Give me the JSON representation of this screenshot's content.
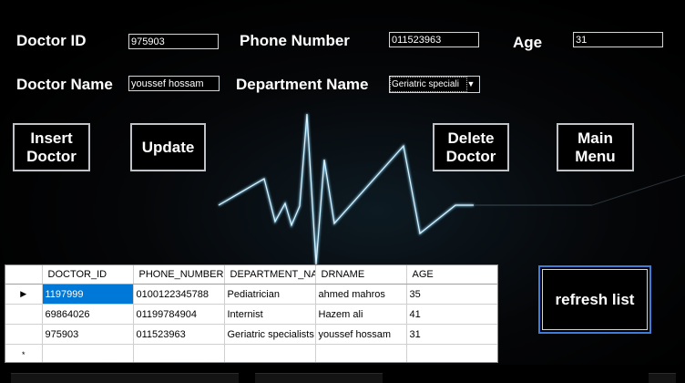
{
  "form": {
    "labels": {
      "doctor_id": "Doctor ID",
      "phone_number": "Phone Number",
      "age": "Age",
      "doctor_name": "Doctor Name",
      "department_name": "Department Name"
    },
    "fields": {
      "doctor_id": "975903",
      "phone_number": "011523963",
      "age": "31",
      "doctor_name": "youssef hossam",
      "department": "Geriatric speciali"
    }
  },
  "buttons": {
    "insert": "Insert Doctor",
    "update": "Update",
    "delete": "Delete Doctor",
    "main_menu": "Main Menu",
    "refresh": "refresh list"
  },
  "grid": {
    "columns": [
      "DOCTOR_ID",
      "PHONE_NUMBER",
      "DEPARTMENT_NA",
      "DRNAME",
      "AGE"
    ],
    "rows": [
      [
        "1197999",
        "0100122345788",
        "Pediatrician",
        "ahmed mahros",
        "35"
      ],
      [
        "69864026",
        "01199784904",
        "Internist",
        "Hazem ali",
        "41"
      ],
      [
        "975903",
        "011523963",
        "Geriatric specialists",
        "youssef hossam",
        "31"
      ]
    ],
    "current_row_marker": "▶",
    "new_row_marker": "*"
  },
  "colors": {
    "background": "#000000",
    "pulse_line": "#a9d8ee",
    "selection": "#0078d7",
    "refresh_border": "#3d7cd8"
  },
  "icons": {
    "dropdown": "chevron-down-icon",
    "current_row": "row-pointer-icon",
    "new_row": "new-row-icon"
  }
}
